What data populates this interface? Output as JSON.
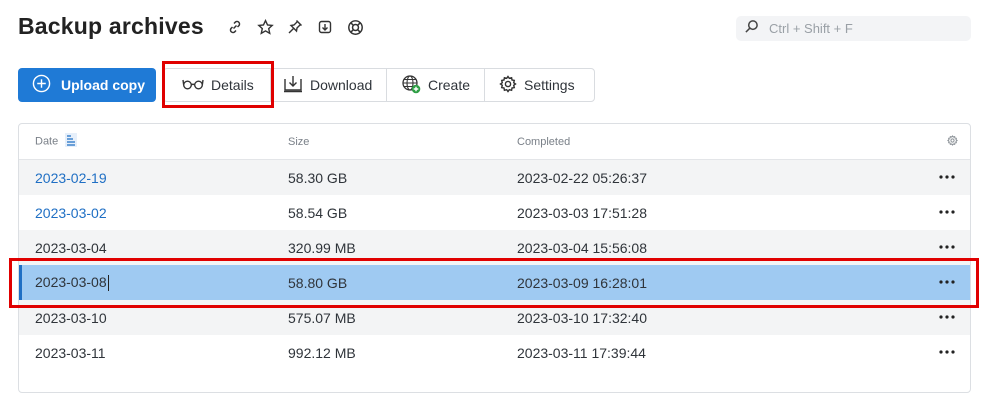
{
  "header": {
    "title": "Backup archives",
    "icons": [
      "link-icon",
      "star-icon",
      "pin-icon",
      "export-icon",
      "help-lifebuoy-icon"
    ]
  },
  "search": {
    "placeholder": "Ctrl + Shift + F",
    "value": ""
  },
  "toolbar": {
    "upload_label": "Upload copy",
    "details_label": "Details",
    "download_label": "Download",
    "create_label": "Create",
    "settings_label": "Settings"
  },
  "table": {
    "headers": {
      "date": "Date",
      "size": "Size",
      "completed": "Completed"
    },
    "rows": [
      {
        "date": "2023-02-19",
        "size": "58.30 GB",
        "completed": "2023-02-22 05:26:37",
        "link": true
      },
      {
        "date": "2023-03-02",
        "size": "58.54 GB",
        "completed": "2023-03-03 17:51:28",
        "link": true
      },
      {
        "date": "2023-03-04",
        "size": "320.99 MB",
        "completed": "2023-03-04 15:56:08",
        "link": false
      },
      {
        "date": "2023-03-08",
        "size": "58.80 GB",
        "completed": "2023-03-09 16:28:01",
        "link": false,
        "selected": true
      },
      {
        "date": "2023-03-10",
        "size": "575.07 MB",
        "completed": "2023-03-10 17:32:40",
        "link": false
      },
      {
        "date": "2023-03-11",
        "size": "992.12 MB",
        "completed": "2023-03-11 17:39:44",
        "link": false
      }
    ]
  },
  "colors": {
    "accent": "#1f7ad6",
    "link": "#1f6fc4",
    "selected_row": "#9fcaf2",
    "highlight": "#e00000"
  }
}
